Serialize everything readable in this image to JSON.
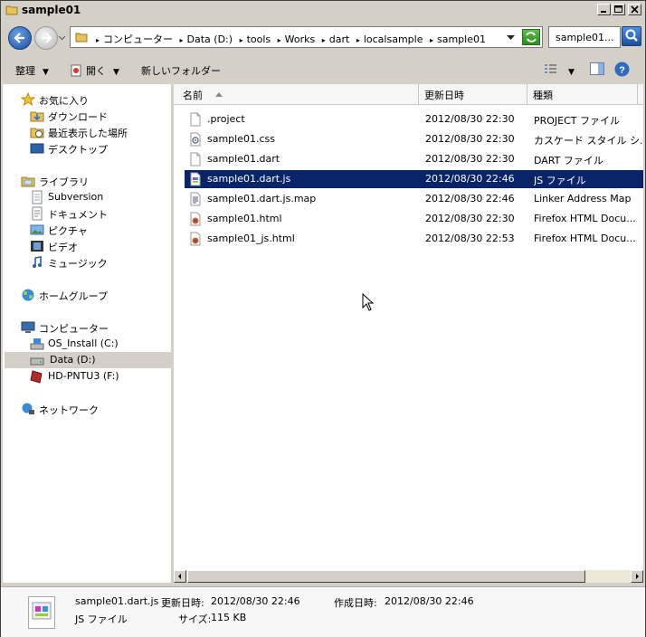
{
  "window": {
    "title": "sample01"
  },
  "address": {
    "crumbs": [
      "コンピューター",
      "Data (D:)",
      "tools",
      "Works",
      "dart",
      "localsample",
      "sample01"
    ],
    "search_text": "sample01..."
  },
  "toolbar": {
    "organize": "整理",
    "open": "開く",
    "new_folder": "新しいフォルダー"
  },
  "nav": {
    "favorites": "お気に入り",
    "downloads": "ダウンロード",
    "recent": "最近表示した場所",
    "desktop": "デスクトップ",
    "libraries": "ライブラリ",
    "subversion": "Subversion",
    "documents": "ドキュメント",
    "pictures": "ピクチャ",
    "videos": "ビデオ",
    "music": "ミュージック",
    "homegroup": "ホームグループ",
    "computer": "コンピューター",
    "drive_c": "OS_Install (C:)",
    "drive_d": "Data (D:)",
    "drive_f": "HD-PNTU3 (F:)",
    "network": "ネットワーク"
  },
  "columns": {
    "name": "名前",
    "modified": "更新日時",
    "type": "種類"
  },
  "files": [
    {
      "name": ".project",
      "modified": "2012/08/30 22:30",
      "type": "PROJECT ファイル",
      "icon": "blank-file-icon"
    },
    {
      "name": "sample01.css",
      "modified": "2012/08/30 22:30",
      "type": "カスケード スタイル シ...",
      "icon": "css-file-icon"
    },
    {
      "name": "sample01.dart",
      "modified": "2012/08/30 22:30",
      "type": "DART ファイル",
      "icon": "blank-file-icon"
    },
    {
      "name": "sample01.dart.js",
      "modified": "2012/08/30 22:46",
      "type": "JS ファイル",
      "icon": "js-file-icon"
    },
    {
      "name": "sample01.dart.js.map",
      "modified": "2012/08/30 22:46",
      "type": "Linker Address Map",
      "icon": "text-file-icon"
    },
    {
      "name": "sample01.html",
      "modified": "2012/08/30 22:30",
      "type": "Firefox HTML Docu...",
      "icon": "firefox-file-icon"
    },
    {
      "name": "sample01_js.html",
      "modified": "2012/08/30 22:53",
      "type": "Firefox HTML Docu...",
      "icon": "firefox-file-icon"
    }
  ],
  "selected_index": 3,
  "details": {
    "filename": "sample01.dart.js",
    "modified_label": "更新日時:",
    "modified_value": "2012/08/30 22:46",
    "created_label": "作成日時:",
    "created_value": "2012/08/30 22:46",
    "type": "JS ファイル",
    "size_label": "サイズ:",
    "size_value": "115 KB"
  }
}
